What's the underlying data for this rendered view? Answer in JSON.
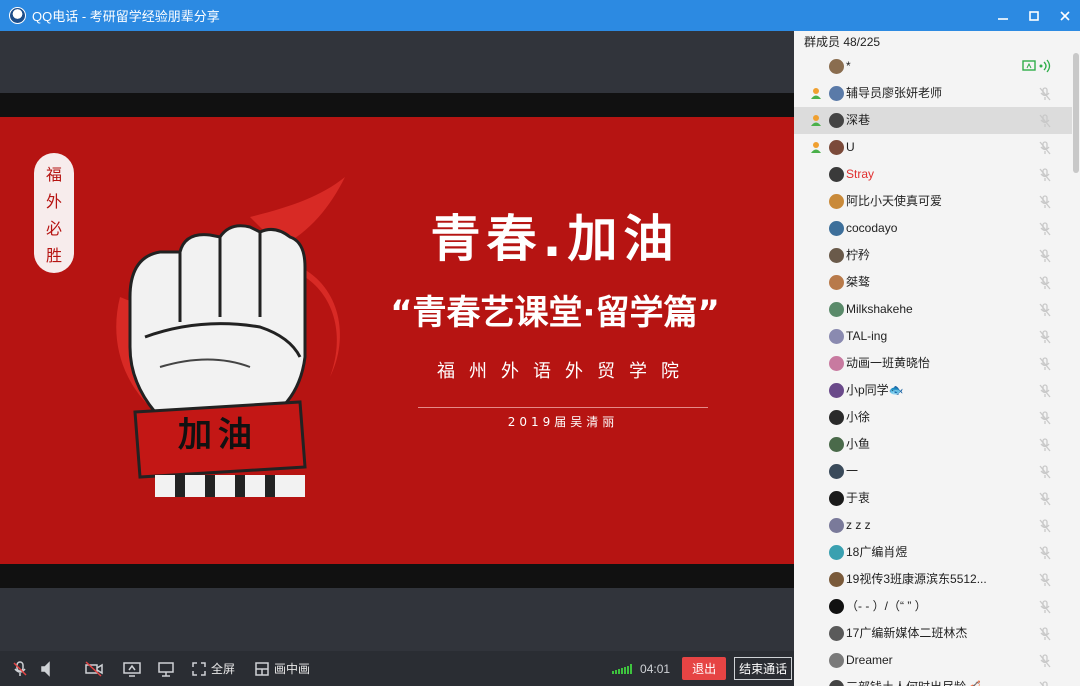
{
  "window": {
    "title": "QQ电话 - 考研留学经验朋辈分享",
    "controls": [
      "minimize-icon",
      "restore-icon",
      "close-icon"
    ]
  },
  "slide": {
    "badge_chars": [
      "福",
      "外",
      "必",
      "胜"
    ],
    "title": "青春.加油",
    "subtitle": "“青春艺课堂·留学篇”",
    "school": "福州外语外贸学院",
    "author": "2019届吴清丽",
    "fist_band_text": "加油"
  },
  "toolbar": {
    "fullscreen_label": "全屏",
    "pip_label": "画中画",
    "timer": "04:01",
    "exit_label": "退出",
    "end_call_label": "结束通话"
  },
  "panel": {
    "header": "群成员 48/225",
    "members": [
      {
        "name": "*",
        "role": "",
        "share": true
      },
      {
        "name": "辅导员廖张妍老师",
        "role": "admin"
      },
      {
        "name": "深巷",
        "role": "admin",
        "selected": true
      },
      {
        "name": "U",
        "role": "admin"
      },
      {
        "name": "Stray",
        "role": "",
        "red": true
      },
      {
        "name": "阿比小天使真可爱",
        "role": ""
      },
      {
        "name": "cocodayo",
        "role": ""
      },
      {
        "name": "柠矜",
        "role": ""
      },
      {
        "name": "桀骜",
        "role": ""
      },
      {
        "name": "Milkshakehe",
        "role": ""
      },
      {
        "name": "TAL-ing",
        "role": ""
      },
      {
        "name": "动画一班黄晓怡",
        "role": ""
      },
      {
        "name": "小p同学🐟",
        "role": ""
      },
      {
        "name": "小徐",
        "role": ""
      },
      {
        "name": "小鱼",
        "role": ""
      },
      {
        "name": "一",
        "role": ""
      },
      {
        "name": "于衷",
        "role": ""
      },
      {
        "name": "z z z",
        "role": ""
      },
      {
        "name": "18广编肖煜",
        "role": ""
      },
      {
        "name": "19视传3班康源滨东5512...",
        "role": ""
      },
      {
        "name": "（- - ）/（“ ” ）",
        "role": ""
      },
      {
        "name": "17广编新媒体二班林杰",
        "role": ""
      },
      {
        "name": "Dreamer",
        "role": ""
      },
      {
        "name": "三部钱土人何时出尽龄🎻",
        "role": ""
      }
    ]
  },
  "colors": {
    "titlebar": "#2c8ae2",
    "slide_red": "#b61412",
    "exit_red": "#e64444",
    "signal_green": "#3ec43e"
  }
}
